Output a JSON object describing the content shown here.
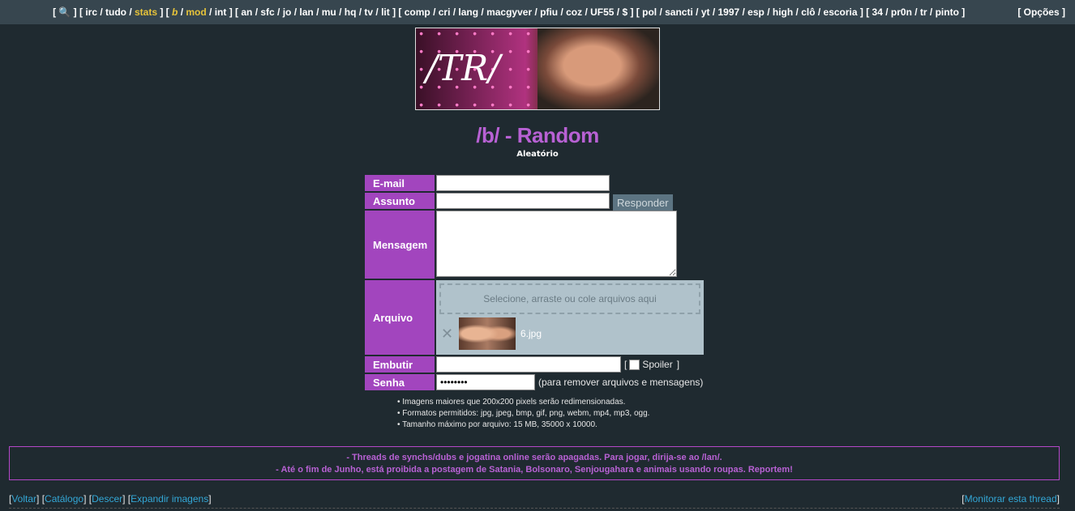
{
  "topbar": {
    "left_nav": "[ 🔍 ] [ irc / tudo / ",
    "stats": "stats",
    "mid1": " ] [ ",
    "b": "b",
    "slash1": " / ",
    "mod": "mod",
    "rest": " / int ] [ an / sfc / jo / lan / mu / hq / tv / lit ] [ comp / cri / lang / macgyver / pfiu / coz / UF55 / $ ] [ pol / sancti / yt / 1997 / esp / high / clô / escoria ] [ 34 / pr0n / tr / pinto ]",
    "options": "[ Opções ]"
  },
  "banner": {
    "logo_text": "/TR/"
  },
  "board": {
    "title": "/b/ - Random",
    "subtitle": "Aleatório"
  },
  "form": {
    "email_label": "E-mail",
    "subject_label": "Assunto",
    "reply_button": "Responder",
    "message_label": "Mensagem",
    "file_label": "Arquivo",
    "dropzone_text": "Selecione, arraste ou cole arquivos aqui",
    "file_name": "6.jpg",
    "embed_label": "Embutir",
    "spoiler_open": "[",
    "spoiler_label": "Spoiler",
    "spoiler_close": "]",
    "password_label": "Senha",
    "password_value": "••••••••",
    "password_note": "(para remover arquivos e mensagens)"
  },
  "notes": [
    "• Imagens maiores que 200x200 pixels serão redimensionadas.",
    "• Formatos permitidos: jpg, jpeg, bmp, gif, png, webm, mp4, mp3, ogg.",
    "• Tamanho máximo por arquivo: 15 MB, 35000 x 10000."
  ],
  "announcements": [
    "- Threads de synchs/dubs e jogatina online serão apagadas. Para jogar, dirija-se ao /lan/.",
    "- Até o fim de Junho, está proibida a postagem de Satania, Bolsonaro, Senjougahara e animais usando roupas. Reportem!"
  ],
  "bottom": {
    "back": "Voltar",
    "catalog": "Catálogo",
    "down": "Descer",
    "expand": "Expandir imagens",
    "watch": "Monitorar esta thread"
  }
}
